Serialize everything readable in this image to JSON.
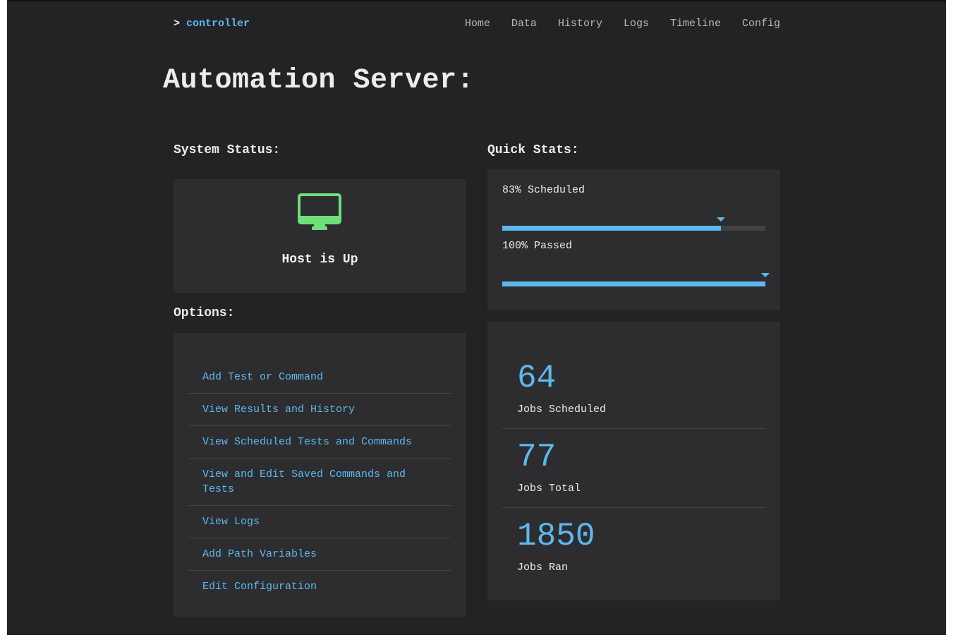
{
  "nav": {
    "prefix": ">",
    "brand": "controller",
    "links": [
      "Home",
      "Data",
      "History",
      "Logs",
      "Timeline",
      "Config"
    ]
  },
  "page_title": "Automation Server:",
  "system_status": {
    "heading": "System Status:",
    "icon": "monitor-icon",
    "icon_color": "#6ee07a",
    "text": "Host is Up"
  },
  "options": {
    "heading": "Options:",
    "items": [
      "Add Test or Command",
      "View Results and History",
      "View Scheduled Tests and Commands",
      "View and Edit Saved Commands and Tests",
      "View Logs",
      "Add Path Variables",
      "Edit Configuration"
    ]
  },
  "quick_stats": {
    "heading": "Quick Stats:",
    "bars": [
      {
        "label": "83% Scheduled",
        "percent": 83
      },
      {
        "label": "100% Passed",
        "percent": 100
      }
    ]
  },
  "counts": [
    {
      "value": "64",
      "label": "Jobs Scheduled"
    },
    {
      "value": "77",
      "label": "Jobs Total"
    },
    {
      "value": "1850",
      "label": "Jobs Ran"
    }
  ],
  "colors": {
    "accent": "#5db8ef",
    "status_ok": "#6ee07a",
    "background": "#232325",
    "panel": "#2d2d2f"
  }
}
